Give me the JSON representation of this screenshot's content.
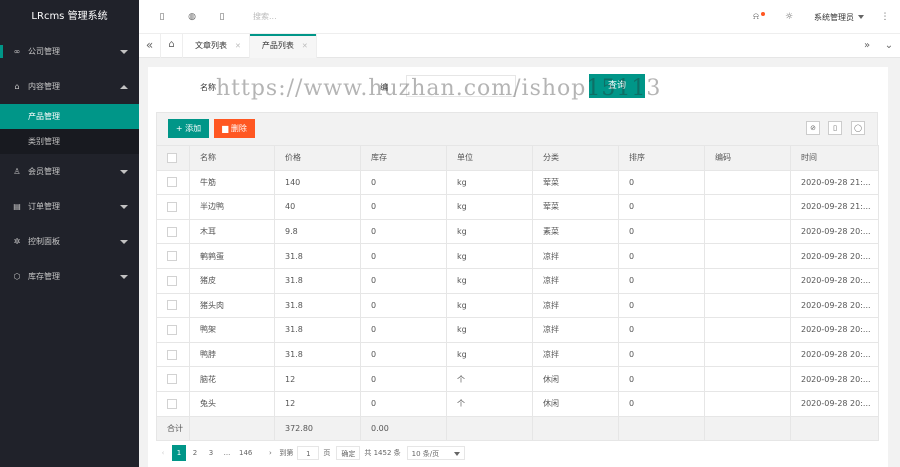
{
  "app": {
    "title": "LRcms 管理系统"
  },
  "sidebar": {
    "items": [
      {
        "icon": "link-icon",
        "glyph": "∞",
        "label": "公司管理",
        "expanded": false
      },
      {
        "icon": "home-icon",
        "glyph": "⌂",
        "label": "内容管理",
        "expanded": true,
        "children": [
          {
            "label": "产品管理",
            "active": true
          },
          {
            "label": "类别管理",
            "active": false
          }
        ]
      },
      {
        "icon": "user-icon",
        "glyph": "♙",
        "label": "会员管理",
        "expanded": false
      },
      {
        "icon": "order-icon",
        "glyph": "▤",
        "label": "订单管理",
        "expanded": false
      },
      {
        "icon": "gear-icon",
        "glyph": "✲",
        "label": "控制面板",
        "expanded": false
      },
      {
        "icon": "box-icon",
        "glyph": "⬡",
        "label": "库存管理",
        "expanded": false
      }
    ]
  },
  "topbar": {
    "search_placeholder": "搜索...",
    "user": "系统管理员"
  },
  "tabs": [
    {
      "label": "文章列表",
      "active": false
    },
    {
      "label": "产品列表",
      "active": true
    }
  ],
  "filter": {
    "name_label": "名称",
    "code_label": "编",
    "search_button": "查询"
  },
  "watermark": "https://www.huzhan.com/ishop15113",
  "toolbar": {
    "add_label": "添加",
    "delete_label": "删除"
  },
  "table": {
    "columns": [
      "名称",
      "价格",
      "库存",
      "单位",
      "分类",
      "排序",
      "编码",
      "时间"
    ],
    "rows": [
      [
        "牛筋",
        "140",
        "0",
        "kg",
        "荤菜",
        "0",
        "",
        "2020-09-28 21:..."
      ],
      [
        "半边鸭",
        "40",
        "0",
        "kg",
        "荤菜",
        "0",
        "",
        "2020-09-28 21:..."
      ],
      [
        "木耳",
        "9.8",
        "0",
        "kg",
        "素菜",
        "0",
        "",
        "2020-09-28 20:..."
      ],
      [
        "鹌鹑蛋",
        "31.8",
        "0",
        "kg",
        "凉拌",
        "0",
        "",
        "2020-09-28 20:..."
      ],
      [
        "猪皮",
        "31.8",
        "0",
        "kg",
        "凉拌",
        "0",
        "",
        "2020-09-28 20:..."
      ],
      [
        "猪头肉",
        "31.8",
        "0",
        "kg",
        "凉拌",
        "0",
        "",
        "2020-09-28 20:..."
      ],
      [
        "鸭架",
        "31.8",
        "0",
        "kg",
        "凉拌",
        "0",
        "",
        "2020-09-28 20:..."
      ],
      [
        "鸭脖",
        "31.8",
        "0",
        "kg",
        "凉拌",
        "0",
        "",
        "2020-09-28 20:..."
      ],
      [
        "脑花",
        "12",
        "0",
        "个",
        "休闲",
        "0",
        "",
        "2020-09-28 20:..."
      ],
      [
        "兔头",
        "12",
        "0",
        "个",
        "休闲",
        "0",
        "",
        "2020-09-28 20:..."
      ]
    ],
    "total": {
      "label": "合计",
      "price": "372.80",
      "stock": "0.00"
    }
  },
  "pager": {
    "pages": [
      "1",
      "2",
      "3",
      "...",
      "146"
    ],
    "goto_label": "到第",
    "goto_value": "1",
    "page_unit": "页",
    "confirm": "确定",
    "total_text": "共 1452 条",
    "page_size": "10 条/页"
  },
  "colors": {
    "accent": "#009688",
    "danger": "#ff5722",
    "sidebar": "#20222a"
  }
}
